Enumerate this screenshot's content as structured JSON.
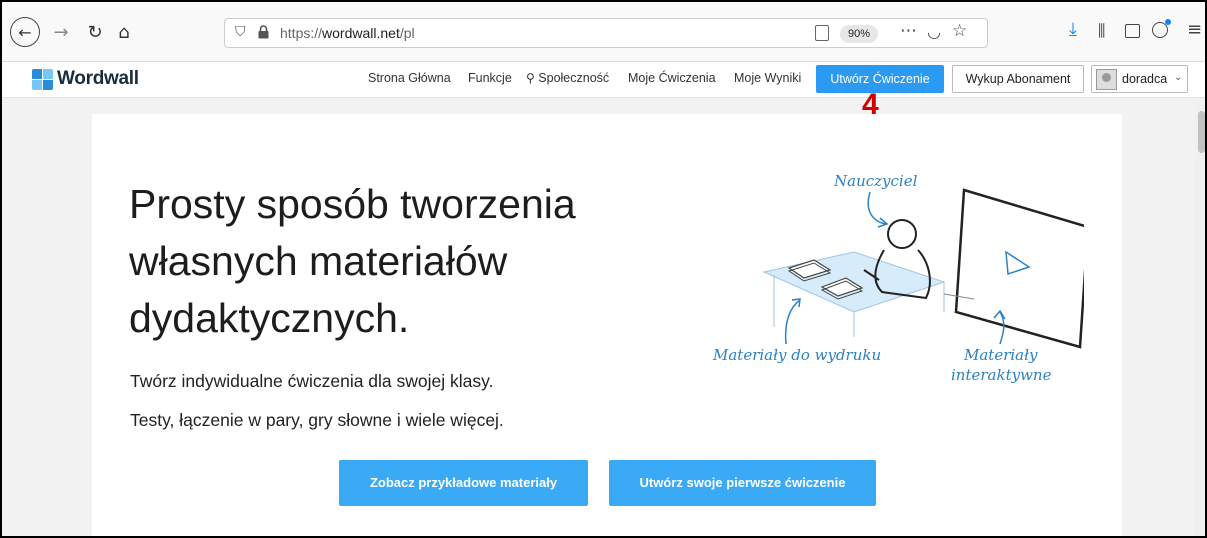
{
  "browser": {
    "url_prefix": "https://",
    "url_domain": "wordwall.net",
    "url_path": "/pl",
    "zoom": "90%"
  },
  "site": {
    "logo": "Wordwall",
    "nav": {
      "home": "Strona Główna",
      "features": "Funkcje",
      "community": "Społeczność",
      "my_activities": "Moje Ćwiczenia",
      "my_results": "Moje Wyniki"
    },
    "create_button": "Utwórz Ćwiczenie",
    "subscribe_button": "Wykup Abonament",
    "user_name": "doradca"
  },
  "annotation": "4",
  "hero": {
    "title": "Prosty sposób tworzenia własnych materiałów dydaktycznych.",
    "subtitle_1": "Twórz indywidualne ćwiczenia dla swojej klasy.",
    "subtitle_2": "Testy, łączenie w pary, gry słowne i wiele więcej.",
    "btn_examples": "Zobacz przykładowe materiały",
    "btn_first": "Utwórz swoje pierwsze ćwiczenie"
  },
  "illustration": {
    "teacher": "Nauczyciel",
    "printables": "Materiały do wydruku",
    "interactive_1": "Materiały",
    "interactive_2": "interaktywne"
  },
  "colors": {
    "accent": "#2b9af3",
    "annotation": "#d40000",
    "illustration_blue": "#2b82c4"
  }
}
